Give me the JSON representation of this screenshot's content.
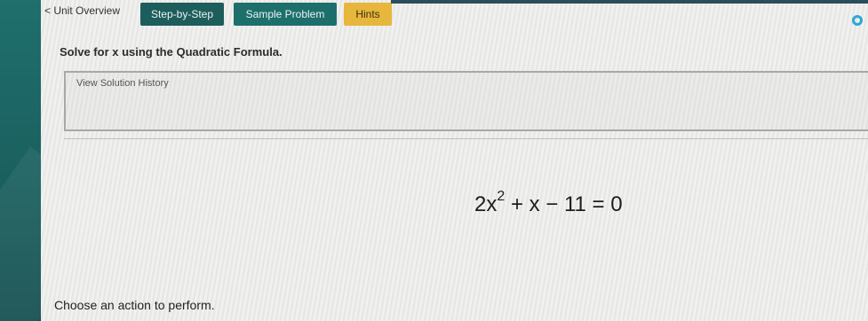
{
  "nav": {
    "back_label": "< Unit Overview"
  },
  "tabs": {
    "step_by_step": "Step-by-Step",
    "sample_problem": "Sample Problem",
    "hints": "Hints"
  },
  "problem": {
    "prompt": "Solve for x using the Quadratic Formula.",
    "history_label": "View Solution History",
    "equation": {
      "coef": "2x",
      "exponent": "2",
      "rest": "+ x − 11 = 0"
    }
  },
  "status": {
    "action_prompt": "Choose an action to perform."
  },
  "icons": {
    "progress": "progress-ring-icon"
  },
  "colors": {
    "teal_dark": "#1d5d5c",
    "teal": "#1d6f6c",
    "hints_yellow": "#e7b63c",
    "ring_blue": "#2fa6d8"
  }
}
